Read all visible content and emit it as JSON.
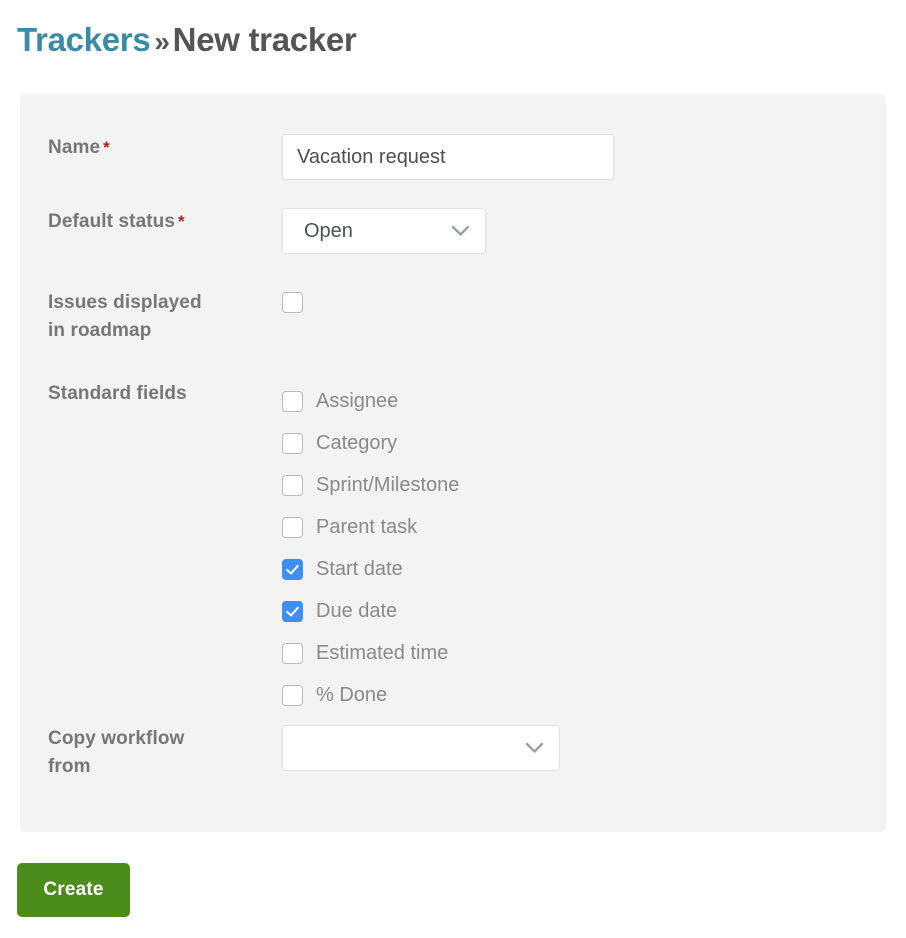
{
  "heading": {
    "breadcrumb_link": "Trackers",
    "separator": "»",
    "current": "New tracker"
  },
  "form": {
    "name": {
      "label": "Name",
      "required_marker": "*",
      "value": "Vacation request",
      "placeholder": ""
    },
    "default_status": {
      "label": "Default status",
      "required_marker": "*",
      "value": "Open"
    },
    "roadmap": {
      "label_line1": "Issues displayed",
      "label_line2": "in roadmap",
      "checked": false
    },
    "standard_fields": {
      "label": "Standard fields",
      "items": [
        {
          "label": "Assignee",
          "checked": false
        },
        {
          "label": "Category",
          "checked": false
        },
        {
          "label": "Sprint/Milestone",
          "checked": false
        },
        {
          "label": "Parent task",
          "checked": false
        },
        {
          "label": "Start date",
          "checked": true
        },
        {
          "label": "Due date",
          "checked": true
        },
        {
          "label": "Estimated time",
          "checked": false
        },
        {
          "label": "% Done",
          "checked": false
        }
      ]
    },
    "copy_workflow": {
      "label_line1": "Copy workflow",
      "label_line2": "from",
      "value": ""
    }
  },
  "actions": {
    "create_label": "Create"
  },
  "colors": {
    "link_teal": "#3a8ba6",
    "heading_gray": "#555555",
    "label_gray": "#777777",
    "required_red": "#b81d23",
    "checkbox_blue": "#3d8ef5",
    "create_green": "#4c8c1b",
    "panel_bg": "#f3f3f3"
  },
  "icons": {
    "chevron_down": "chevron-down-icon",
    "check": "check-icon"
  }
}
